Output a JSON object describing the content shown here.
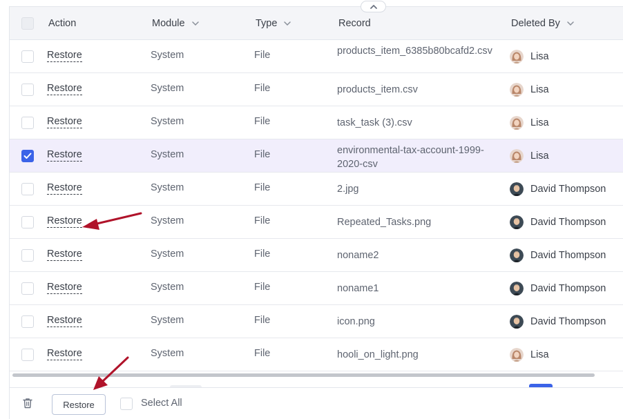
{
  "table": {
    "columns": [
      {
        "label": "Action",
        "sortable": false
      },
      {
        "label": "Module",
        "sortable": true
      },
      {
        "label": "Type",
        "sortable": true
      },
      {
        "label": "Record",
        "sortable": false
      },
      {
        "label": "Deleted By",
        "sortable": true
      }
    ],
    "rows": [
      {
        "action": "Restore",
        "module": "System",
        "type": "File",
        "record": "products_item_6385b80bcafd2.csv",
        "deleted_by": "Lisa",
        "avatar": "female",
        "checked": false
      },
      {
        "action": "Restore",
        "module": "System",
        "type": "File",
        "record": "products_item.csv",
        "deleted_by": "Lisa",
        "avatar": "female",
        "checked": false
      },
      {
        "action": "Restore",
        "module": "System",
        "type": "File",
        "record": "task_task (3).csv",
        "deleted_by": "Lisa",
        "avatar": "female",
        "checked": false
      },
      {
        "action": "Restore",
        "module": "System",
        "type": "File",
        "record": "environmental-tax-account-1999-2020-csv",
        "deleted_by": "Lisa",
        "avatar": "female",
        "checked": true
      },
      {
        "action": "Restore",
        "module": "System",
        "type": "File",
        "record": "2.jpg",
        "deleted_by": "David Thompson",
        "avatar": "male",
        "checked": false
      },
      {
        "action": "Restore",
        "module": "System",
        "type": "File",
        "record": "Repeated_Tasks.png",
        "deleted_by": "David Thompson",
        "avatar": "male",
        "checked": false
      },
      {
        "action": "Restore",
        "module": "System",
        "type": "File",
        "record": "noname2",
        "deleted_by": "David Thompson",
        "avatar": "male",
        "checked": false
      },
      {
        "action": "Restore",
        "module": "System",
        "type": "File",
        "record": "noname1",
        "deleted_by": "David Thompson",
        "avatar": "male",
        "checked": false
      },
      {
        "action": "Restore",
        "module": "System",
        "type": "File",
        "record": "icon.png",
        "deleted_by": "David Thompson",
        "avatar": "male",
        "checked": false
      },
      {
        "action": "Restore",
        "module": "System",
        "type": "File",
        "record": "hooli_on_light.png",
        "deleted_by": "Lisa",
        "avatar": "female",
        "checked": false
      }
    ]
  },
  "footer": {
    "restore_label": "Restore",
    "select_all_label": "Select All"
  },
  "colors": {
    "accent": "#3b63e8",
    "selected_row": "#f1eefc",
    "annotation_arrow": "#b0132a"
  },
  "icons": {
    "collapse": "chevron-up-icon",
    "sort": "chevron-down-icon",
    "delete": "trash-icon",
    "check": "checkmark-icon"
  }
}
